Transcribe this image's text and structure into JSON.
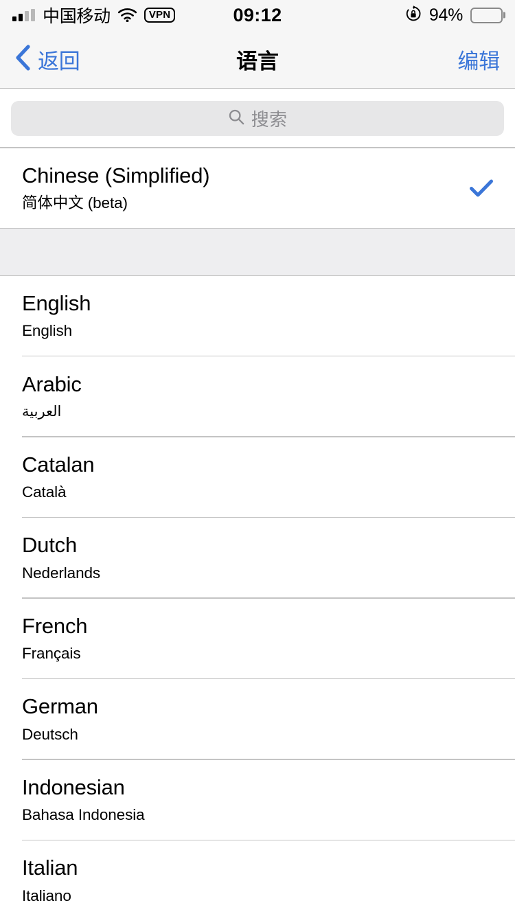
{
  "status_bar": {
    "carrier": "中国移动",
    "signal_icon": "signal-bars-icon",
    "signal_bars_filled": 2,
    "signal_bars_total": 4,
    "wifi_icon": "wifi-icon",
    "vpn_badge": "VPN",
    "time": "09:12",
    "rotation_lock_icon": "rotation-lock-icon",
    "battery_percent": "94%",
    "battery_icon": "battery-icon",
    "battery_level": 94
  },
  "nav_bar": {
    "back_label": "返回",
    "back_icon": "chevron-left-icon",
    "title": "语言",
    "edit_label": "编辑"
  },
  "search": {
    "placeholder": "搜索",
    "icon": "search-icon",
    "value": ""
  },
  "selected_section": {
    "rows": [
      {
        "title": "Chinese (Simplified)",
        "subtitle": "简体中文 (beta)",
        "selected": true,
        "check_icon": "checkmark-icon"
      }
    ]
  },
  "languages_section": {
    "rows": [
      {
        "title": "English",
        "subtitle": "English",
        "selected": false,
        "rtl": false
      },
      {
        "title": "Arabic",
        "subtitle": "العربية",
        "selected": false,
        "rtl": true
      },
      {
        "title": "Catalan",
        "subtitle": "Català",
        "selected": false,
        "rtl": false
      },
      {
        "title": "Dutch",
        "subtitle": "Nederlands",
        "selected": false,
        "rtl": false
      },
      {
        "title": "French",
        "subtitle": "Français",
        "selected": false,
        "rtl": false
      },
      {
        "title": "German",
        "subtitle": "Deutsch",
        "selected": false,
        "rtl": false
      },
      {
        "title": "Indonesian",
        "subtitle": "Bahasa Indonesia",
        "selected": false,
        "rtl": false
      },
      {
        "title": "Italian",
        "subtitle": "Italiano",
        "selected": false,
        "rtl": false
      }
    ]
  },
  "colors": {
    "accent_blue": "#3b76d8",
    "nav_background": "#f6f6f6",
    "search_background": "#e7e7e8",
    "section_gap": "#eeeef0",
    "separator": "#c4c4c4",
    "placeholder_text": "#8c8c90"
  }
}
